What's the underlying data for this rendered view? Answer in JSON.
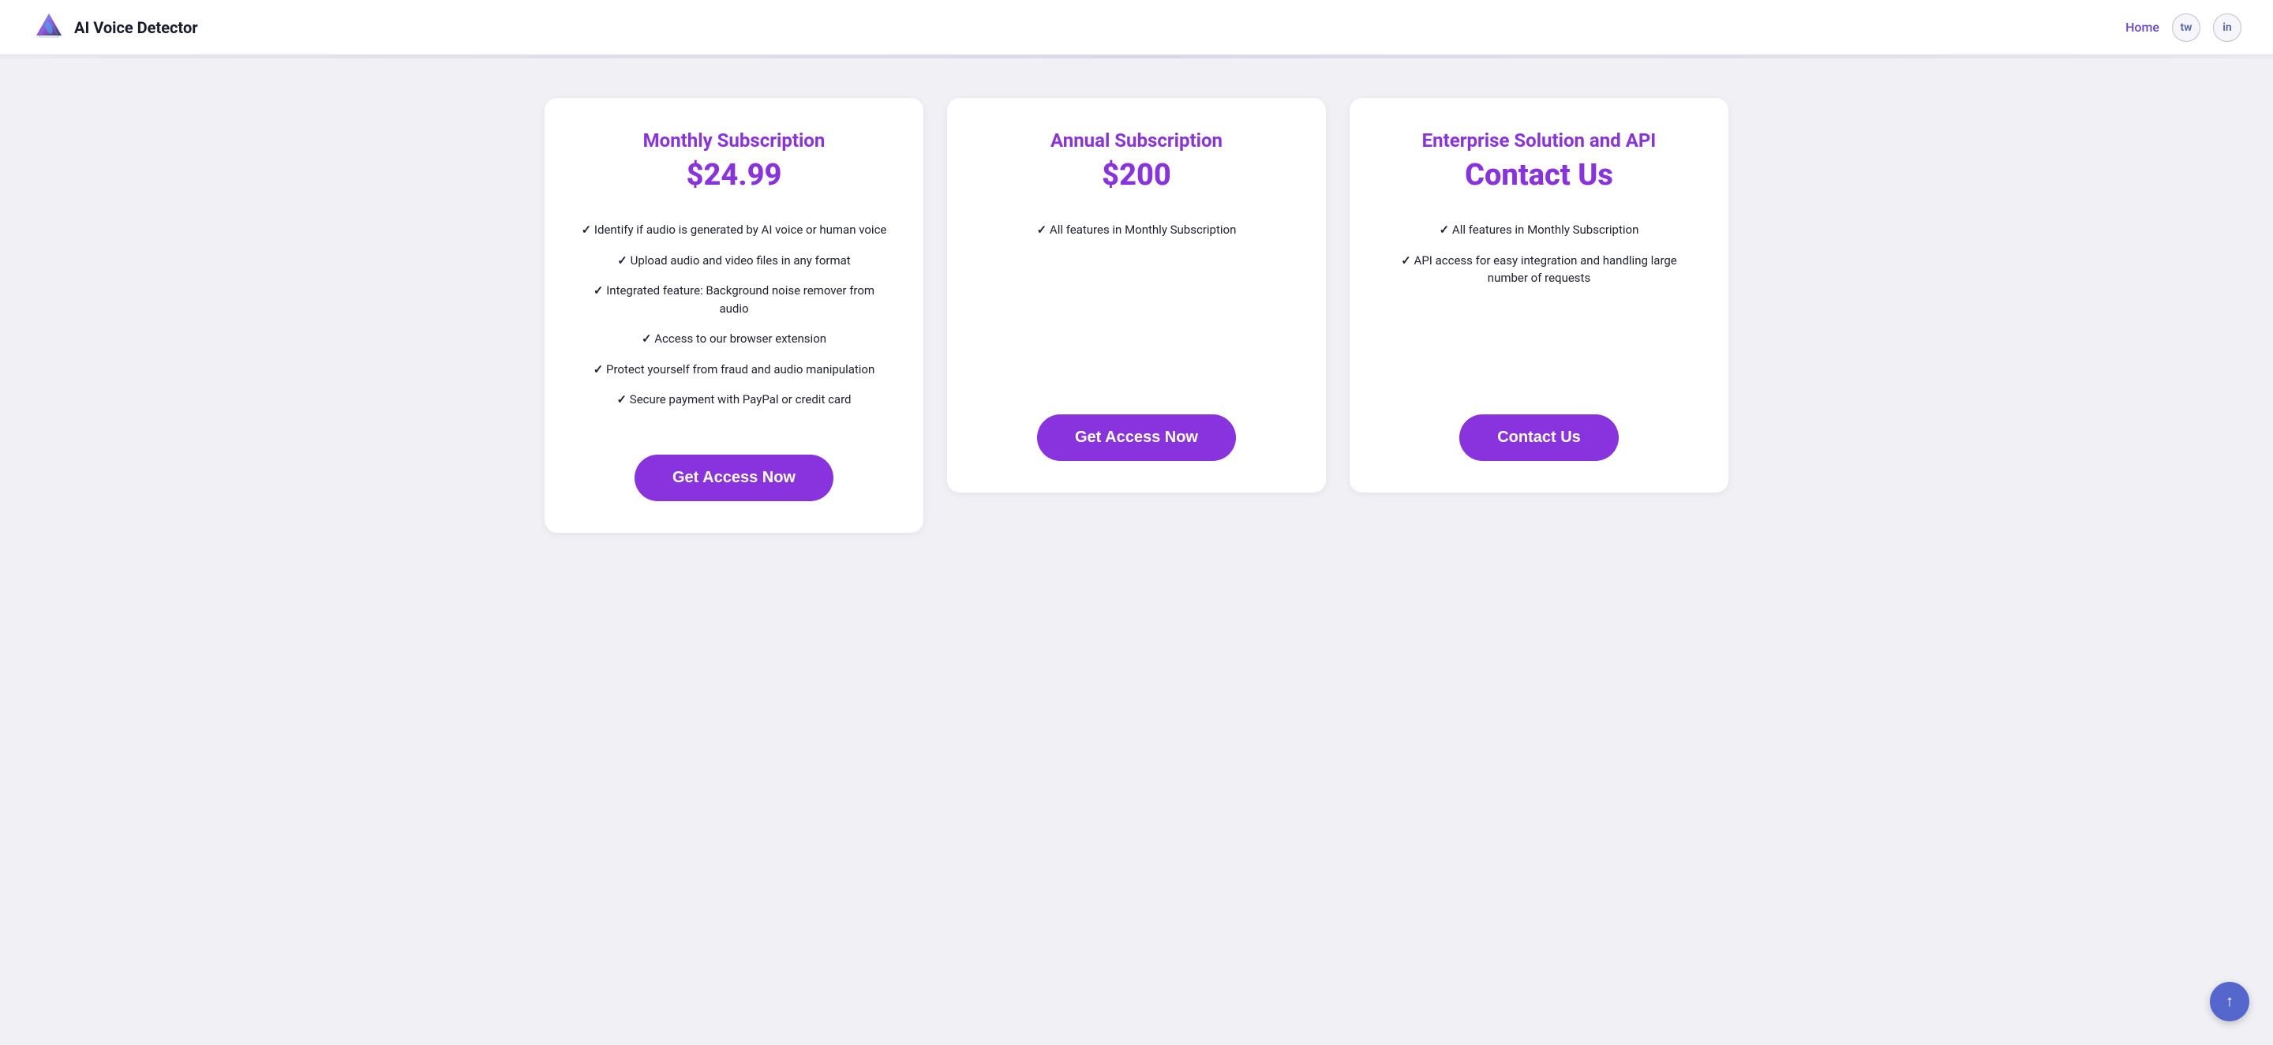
{
  "header": {
    "logo_text": "AI Voice Detector",
    "nav_home": "Home",
    "twitter_label": "tw",
    "linkedin_label": "in"
  },
  "pricing": {
    "monthly": {
      "title": "Monthly Subscription",
      "price": "$24.99",
      "features": [
        "Identify if audio is generated by AI voice or human voice",
        "Upload audio and video files in any format",
        "Integrated feature: Background noise remover from audio",
        "Access to our browser extension",
        "Protect yourself from fraud and audio manipulation",
        "Secure payment with PayPal or credit card"
      ],
      "cta": "Get Access Now"
    },
    "annual": {
      "title": "Annual Subscription",
      "price": "$200",
      "features": [
        "All features in Monthly Subscription"
      ],
      "cta": "Get Access Now"
    },
    "enterprise": {
      "title": "Enterprise Solution and API",
      "price": "Contact Us",
      "features": [
        "All features in Monthly Subscription",
        "API access for easy integration and handling large number of requests"
      ],
      "cta": "Contact Us"
    }
  },
  "scroll_top": "↑"
}
